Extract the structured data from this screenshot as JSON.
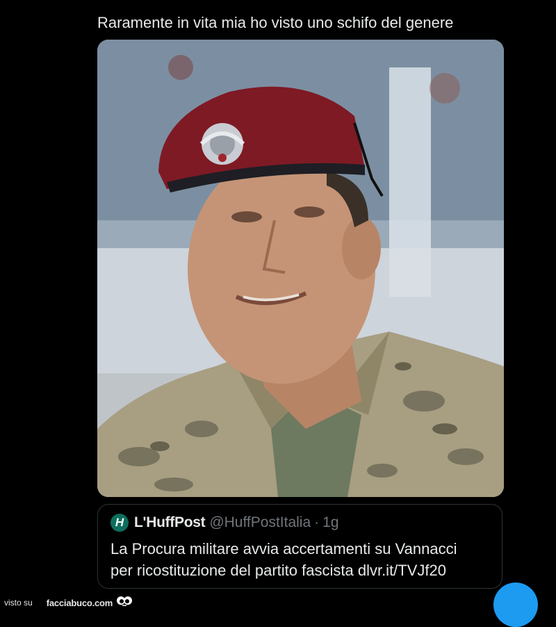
{
  "tweet": {
    "text": "Raramente in vita mia ho visto uno schifo del genere"
  },
  "quoted_tweet": {
    "avatar_letter": "H",
    "account_name": "L'HuffPost",
    "handle": "@HuffPostItalia",
    "separator": "·",
    "time": "1g",
    "text_line1": "La Procura militare avvia accertamenti su Vannacci",
    "text_line2": "per ricostituzione del partito fascista dlvr.it/TVJf20"
  },
  "watermark": {
    "prefix": "visto su",
    "site": "facciabuco.com",
    "logo_icon": "googly-eyes-icon"
  },
  "colors": {
    "background": "#000000",
    "text": "#e7e9ea",
    "muted": "#71767b",
    "border": "#2f3336",
    "accent": "#1d9bf0",
    "huffpost_green": "#0d6e5d"
  }
}
